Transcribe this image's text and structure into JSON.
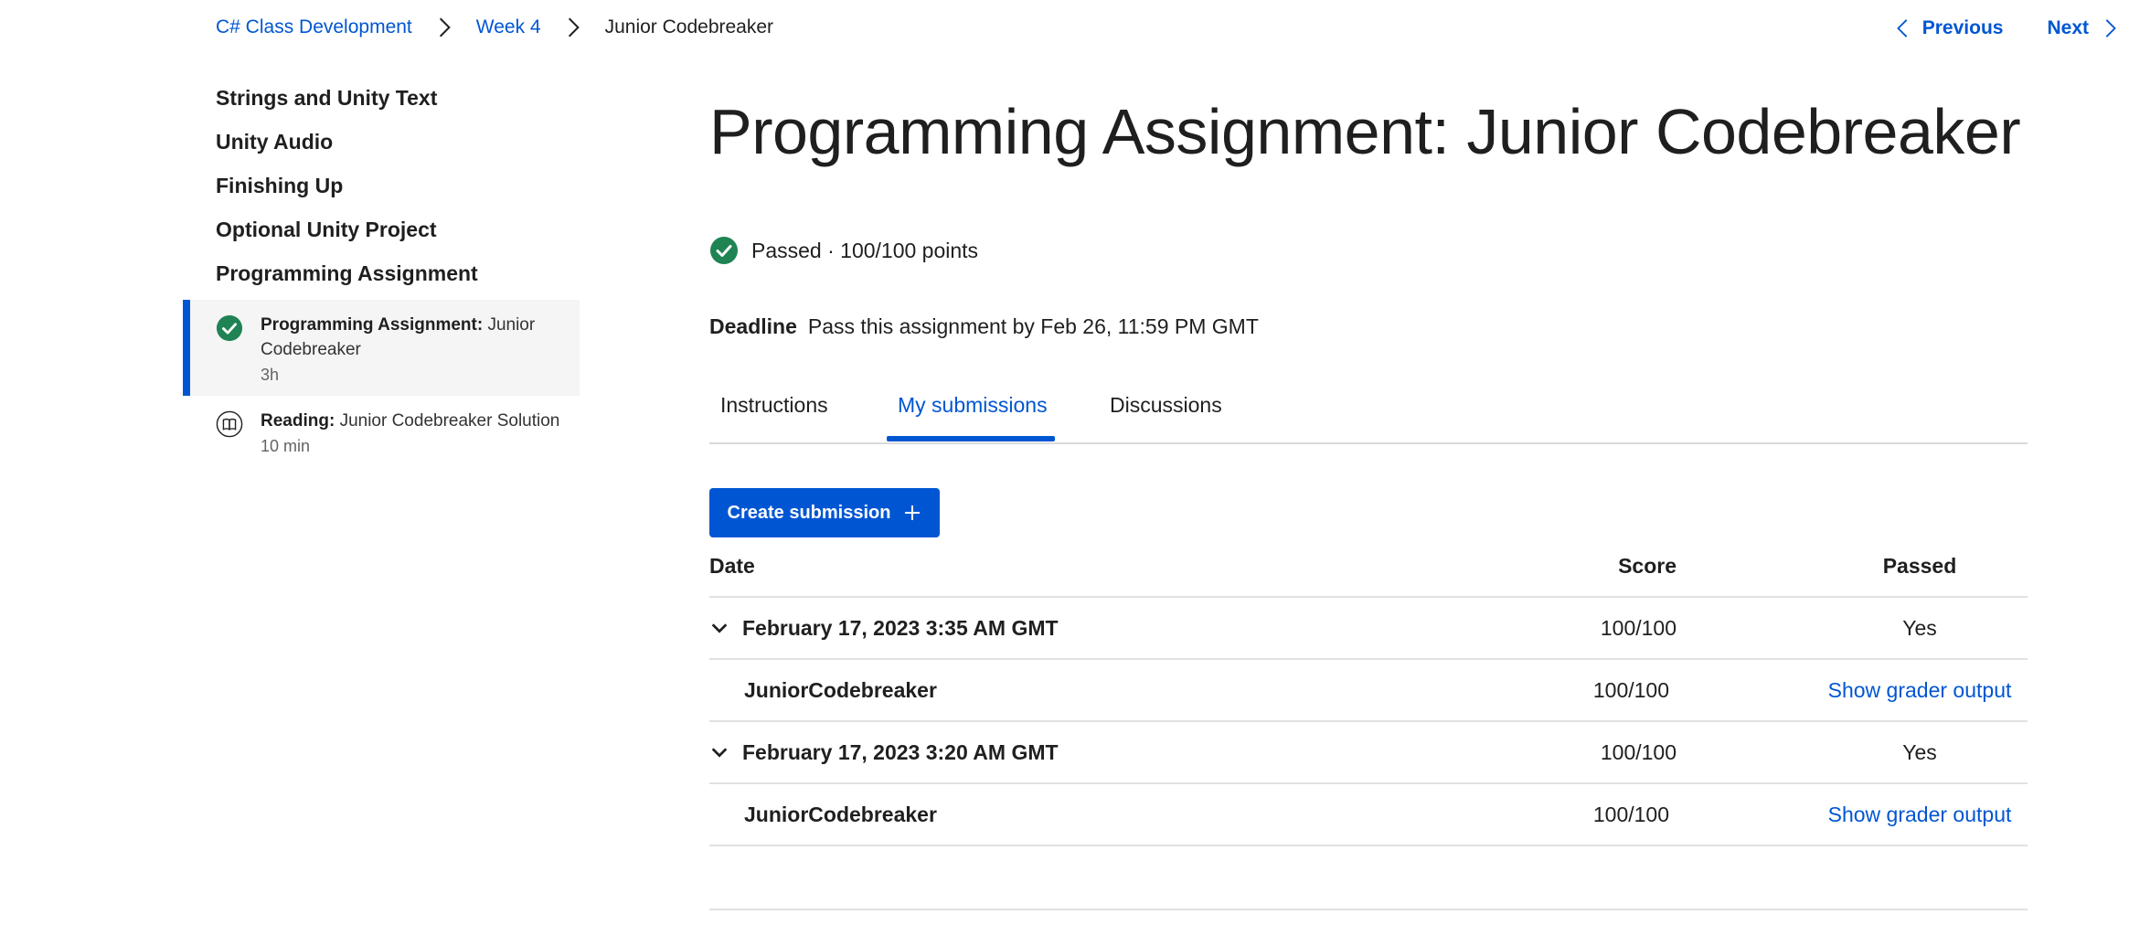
{
  "breadcrumb": {
    "course": "C# Class Development",
    "week": "Week 4",
    "current": "Junior Codebreaker"
  },
  "nav": {
    "previous": "Previous",
    "next": "Next"
  },
  "sidebar": {
    "sections": [
      "Strings and Unity Text",
      "Unity Audio",
      "Finishing Up",
      "Optional Unity Project",
      "Programming Assignment"
    ],
    "items": [
      {
        "type": "Programming Assignment:",
        "name": "Junior Codebreaker",
        "duration": "3h",
        "icon": "check-circle-icon",
        "status": "completed"
      },
      {
        "type": "Reading:",
        "name": "Junior Codebreaker Solution",
        "duration": "10 min",
        "icon": "book-icon",
        "status": "pending"
      }
    ]
  },
  "main": {
    "title": "Programming Assignment: Junior Codebreaker",
    "status": "Passed · 100/100 points",
    "deadline_label": "Deadline",
    "deadline_text": "Pass this assignment by Feb 26, 11:59 PM GMT",
    "tabs": [
      "Instructions",
      "My submissions",
      "Discussions"
    ],
    "selected_tab": "My submissions",
    "create_button": "Create submission"
  },
  "submissions": {
    "headers": {
      "date": "Date",
      "score": "Score",
      "passed": "Passed"
    },
    "rows": [
      {
        "date": "February 17, 2023 3:35 AM GMT",
        "score": "100/100",
        "passed": "Yes",
        "file": {
          "name": "JuniorCodebreaker",
          "score": "100/100",
          "link": "Show grader output"
        }
      },
      {
        "date": "February 17, 2023 3:20 AM GMT",
        "score": "100/100",
        "passed": "Yes",
        "file": {
          "name": "JuniorCodebreaker",
          "score": "100/100",
          "link": "Show grader output"
        }
      }
    ]
  },
  "colors": {
    "accent": "#0056d2",
    "success": "#1f8354",
    "text": "#1f1f1f",
    "active_bg": "#f5f5f5",
    "divider": "#e1e1e1"
  }
}
